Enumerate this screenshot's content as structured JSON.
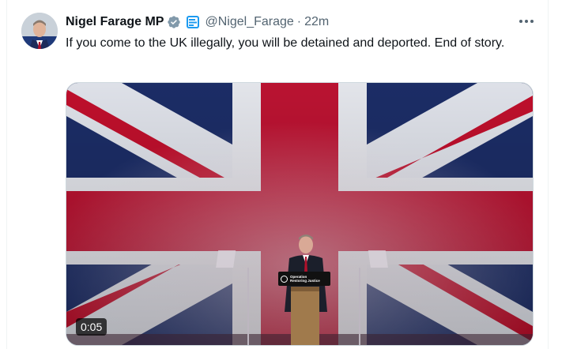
{
  "tweet": {
    "author_name": "Nigel Farage MP",
    "handle": "@Nigel_Farage",
    "separator": "·",
    "time": "22m",
    "text": "If you come to the UK illegally, you will be detained and deported. End of story.",
    "verified_icon": "verified-badge-icon",
    "affiliation_icon": "government-affiliation-icon",
    "more_icon": "more-options-icon"
  },
  "media": {
    "type": "video",
    "duration": "0:05",
    "lectern_sign": "Operation\nRestoring Justice"
  },
  "colors": {
    "text_primary": "#0f1419",
    "text_secondary": "#536471",
    "verified": "#829aab",
    "flag_blue": "#1d2f6b",
    "flag_red": "#c8102e"
  }
}
